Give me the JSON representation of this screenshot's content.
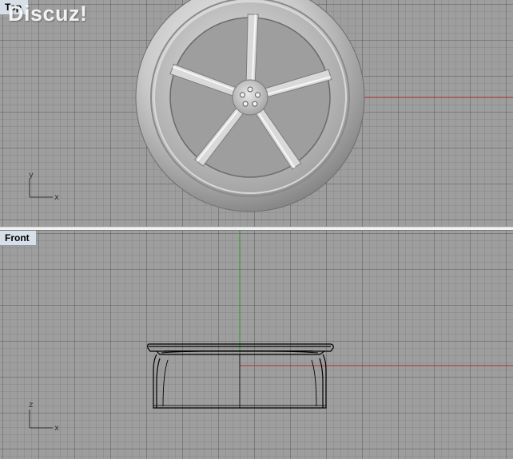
{
  "viewports": {
    "top": {
      "label": "Top",
      "axis_labels": {
        "horizontal": "x",
        "vertical": "y"
      }
    },
    "front": {
      "label": "Front",
      "axis_labels": {
        "horizontal": "x",
        "vertical": "z"
      }
    }
  },
  "watermark": "Discuz!",
  "colors": {
    "x_axis": "#b03030",
    "y_axis": "#2a9a2a",
    "viewport_bg": "#9e9e9e",
    "label_bg": "#d7dfe8"
  },
  "model": {
    "type": "wheel-rim",
    "spoke_count": 5,
    "lug_count": 5
  }
}
